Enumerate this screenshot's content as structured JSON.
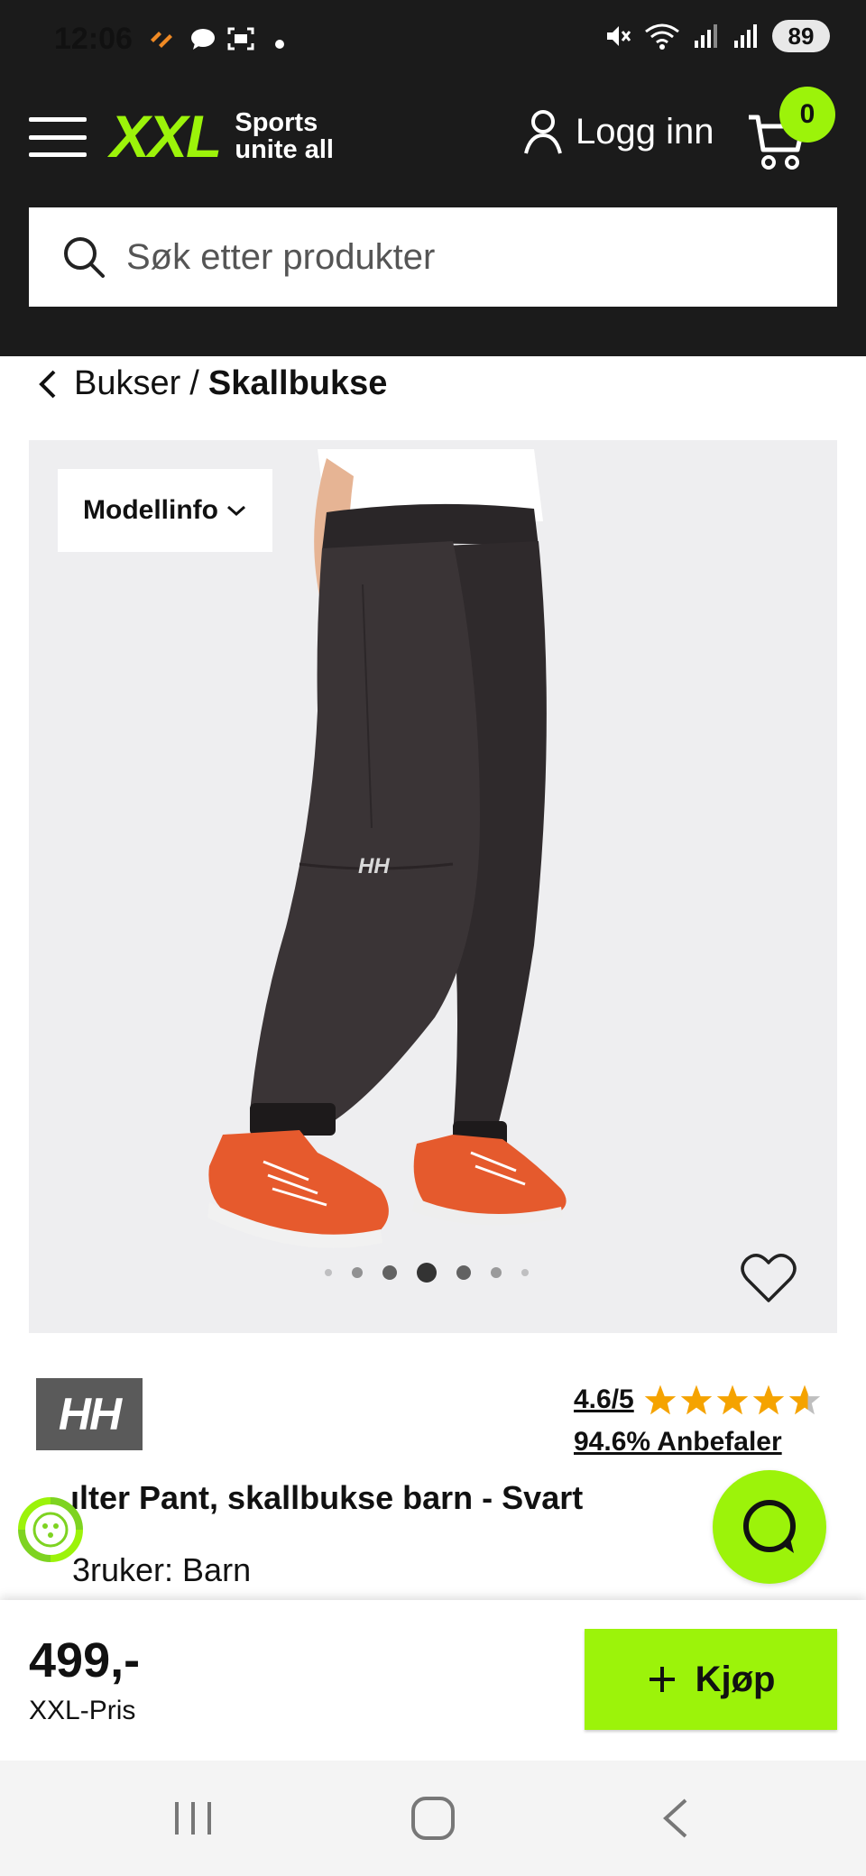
{
  "status_bar": {
    "time": "12:06",
    "battery": "89"
  },
  "header": {
    "logo_text": "XXL",
    "logo_tagline_1": "Sports",
    "logo_tagline_2": "unite all",
    "login_label": "Logg inn",
    "cart_count": "0"
  },
  "search": {
    "placeholder": "Søk etter produkter"
  },
  "breadcrumb": {
    "parent": "Bukser",
    "separator": "/",
    "current": "Skallbukse"
  },
  "gallery": {
    "modellinfo_label": "Modellinfo",
    "brand_on_pants": "HH",
    "active_image": 4,
    "total_dots": 7
  },
  "product": {
    "brand": "HH",
    "rating": "4.6/5",
    "rating_value": 4.6,
    "recommend": "94.6% Anbefaler",
    "title": "Shelter Pant, skallbukse barn - Svart",
    "title_visible": "ılter Pant, skallbukse barn - Svart",
    "user_line": "Bruker: Barn",
    "user_line_visible": "3ruker: Barn"
  },
  "buy_bar": {
    "price": "499,-",
    "price_label": "XXL-Pris",
    "buy_label": "Kjøp",
    "buy_icon": "plus-icon"
  },
  "colors": {
    "brand_green": "#9cf30a",
    "header_bg": "#1b1b1b",
    "star": "#f5a300"
  }
}
